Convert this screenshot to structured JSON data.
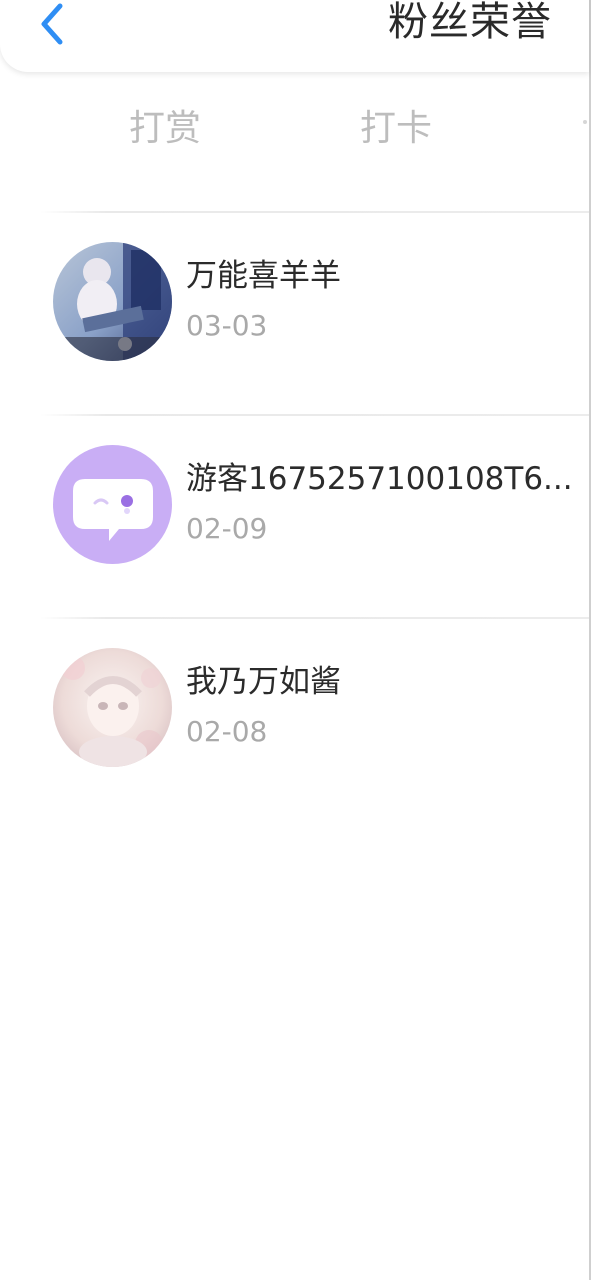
{
  "header": {
    "title": "粉丝荣誉",
    "back_icon": "chevron-left-icon",
    "accent_color": "#2f8ef4"
  },
  "tabs": [
    {
      "label": "打赏"
    },
    {
      "label": "打卡"
    }
  ],
  "fans": [
    {
      "name": "万能喜羊羊",
      "date": "03-03",
      "avatar": "photo-avatar"
    },
    {
      "name": "游客1675257100108T6...",
      "date": "02-09",
      "avatar": "chat-bubble-avatar",
      "avatar_color": "#c9aef5"
    },
    {
      "name": "我乃万如酱",
      "date": "02-08",
      "avatar": "anime-girl-avatar"
    }
  ]
}
